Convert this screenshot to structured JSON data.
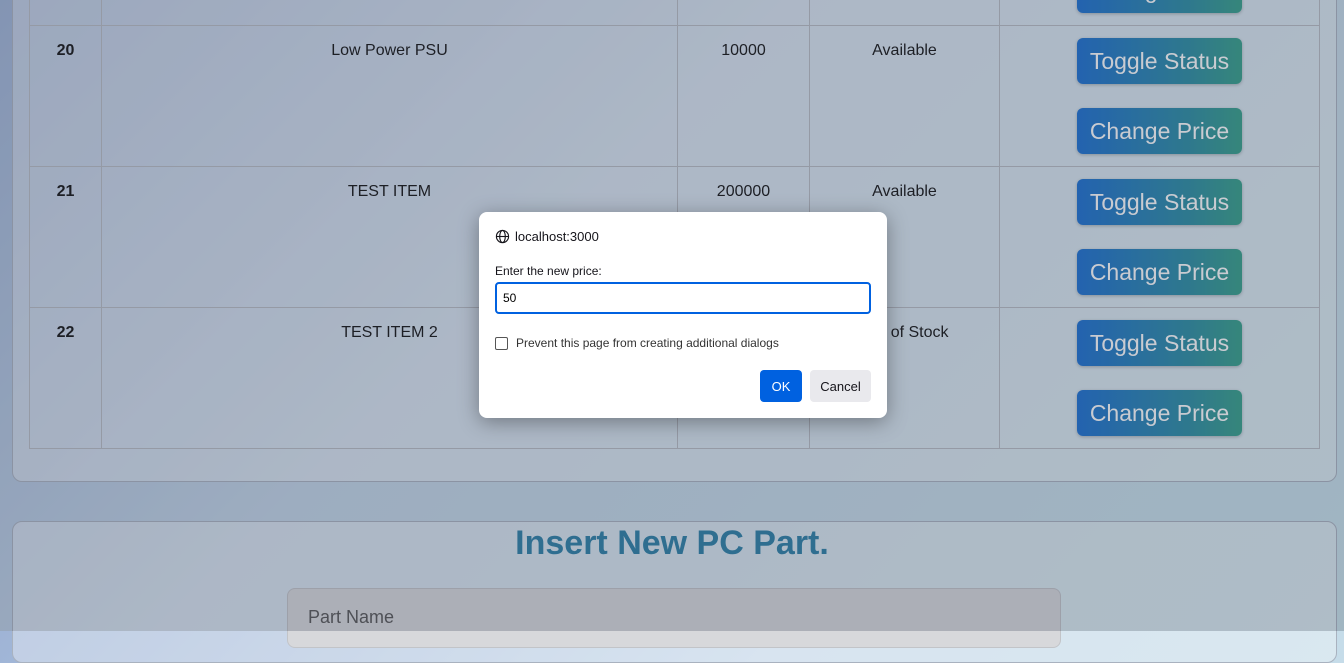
{
  "table": {
    "rows": [
      {
        "id": "",
        "name": "",
        "price": "",
        "status": ""
      },
      {
        "id": "20",
        "name": "Low Power PSU",
        "price": "10000",
        "status": "Available"
      },
      {
        "id": "21",
        "name": "TEST ITEM",
        "price": "200000",
        "status": "Available"
      },
      {
        "id": "22",
        "name": "TEST ITEM 2",
        "price": "",
        "status": "Out of Stock"
      }
    ],
    "toggle_label": "Toggle Status",
    "change_label": "Change Price"
  },
  "insert": {
    "title": "Insert New PC Part.",
    "part_name_placeholder": "Part Name"
  },
  "dialog": {
    "origin": "localhost:3000",
    "message": "Enter the new price:",
    "input_value": "50",
    "prevent_label": "Prevent this page from creating additional dialogs",
    "ok_label": "OK",
    "cancel_label": "Cancel"
  },
  "colors": {
    "accent": "#0061e0",
    "title": "#2a7fa6"
  }
}
